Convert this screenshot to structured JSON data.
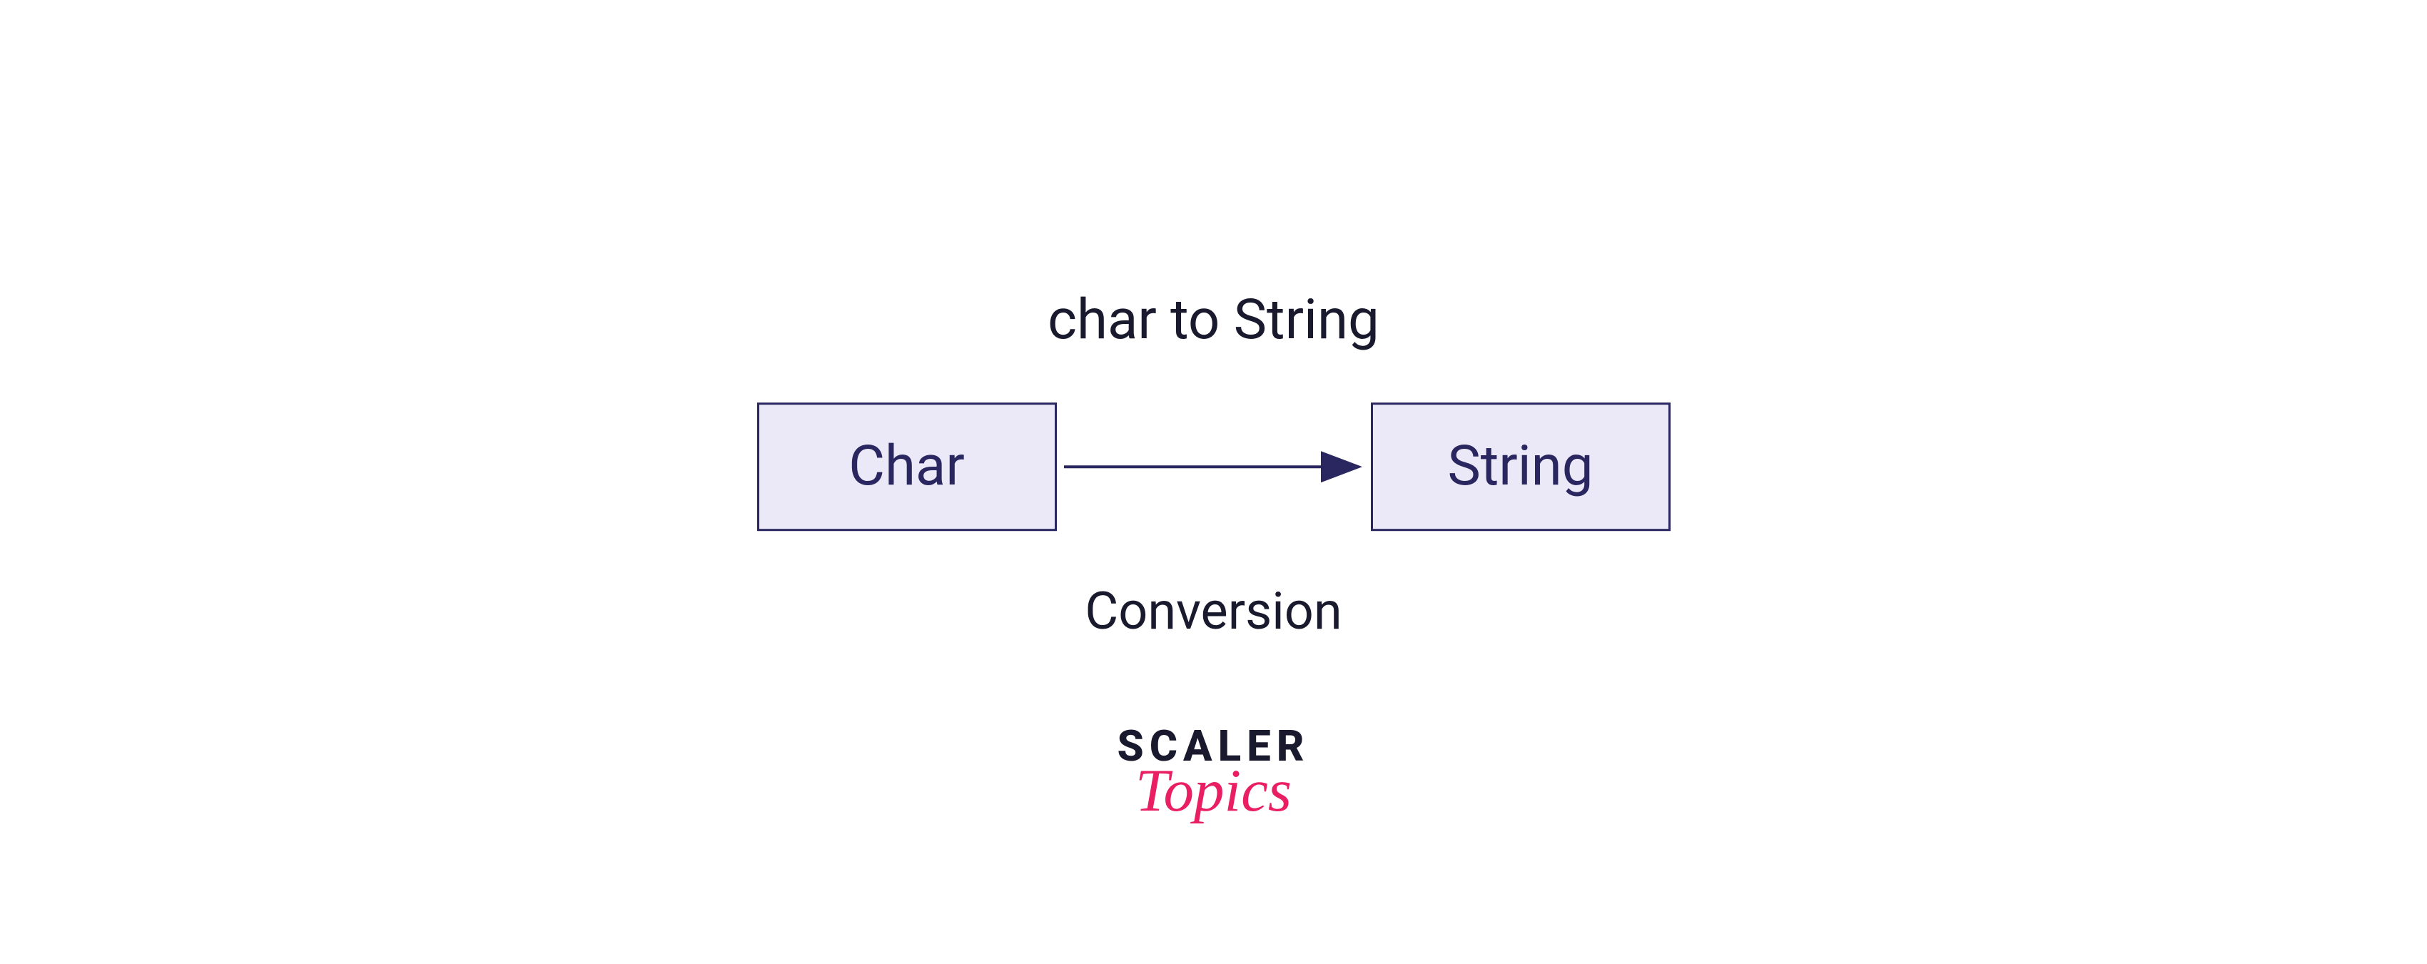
{
  "diagram": {
    "title": "char to String",
    "source_box": "Char",
    "target_box": "String",
    "subtitle": "Conversion"
  },
  "logo": {
    "line1": "SCALER",
    "line2": "Topics"
  },
  "colors": {
    "box_fill": "#ebe9f8",
    "box_border": "#2a2760",
    "text_dark": "#1a1a2e",
    "accent_pink": "#e91e63"
  }
}
